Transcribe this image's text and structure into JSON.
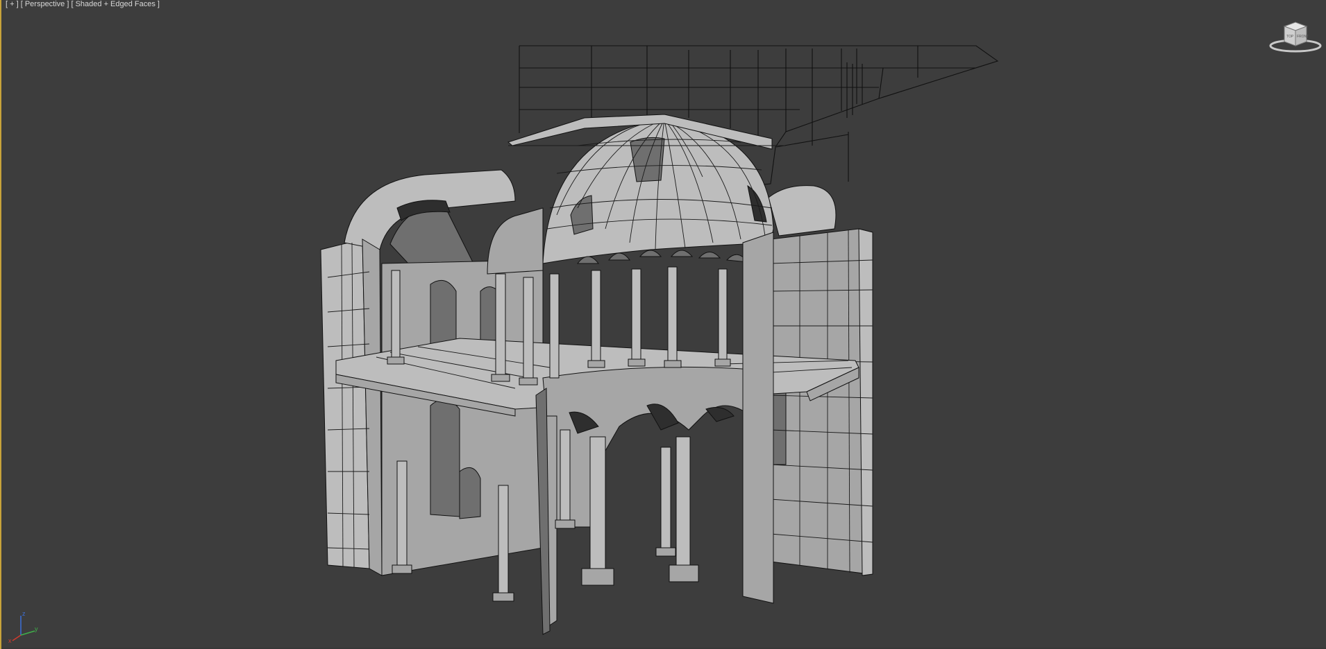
{
  "viewport": {
    "label_plus": "[ + ]",
    "label_view": "[ Perspective ]",
    "label_shading": "[ Shaded + Edged Faces ]",
    "accent_border": "#c8a33a",
    "background": "#3d3d3d"
  },
  "viewcube": {
    "left_face": "TOP",
    "right_face": "FRONT"
  },
  "axis_gizmo": {
    "z": "z",
    "y": "y",
    "x": "x"
  }
}
